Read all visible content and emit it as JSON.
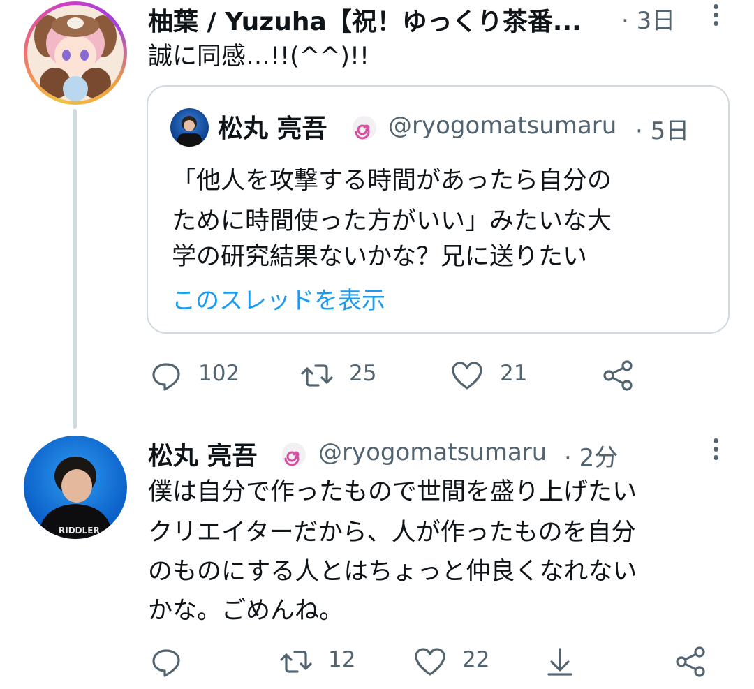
{
  "tweet1": {
    "display_name": "柚葉 / Yuzuha【祝！ゆっくり茶番...",
    "time": "· 3日",
    "text": "誠に同感…!!(^^)!!",
    "quote": {
      "display_name": "松丸 亮吾",
      "handle": "@ryogomatsumaru",
      "time": "· 5日",
      "lines": [
        "「他人を攻撃する時間があったら自分の",
        "ために時間使った方がいい」みたいな大",
        "学の研究結果ないかな？兄に送りたい"
      ],
      "show_thread": "このスレッドを表示"
    },
    "actions": {
      "replies": "102",
      "retweets": "25",
      "likes": "21"
    }
  },
  "tweet2": {
    "display_name": "松丸 亮吾",
    "handle": "@ryogomatsumaru",
    "time": "· 2分",
    "lines": [
      "僕は自分で作ったもので世間を盛り上げたい",
      "クリエイターだから、人が作ったものを自分",
      "のものにする人とはちょっと仲良くなれない",
      "かな。ごめんね。"
    ],
    "actions": {
      "replies": "",
      "retweets": "12",
      "likes": "22"
    }
  },
  "avatar2_shirt_text": "RIDDLER",
  "colors": {
    "link": "#1d9bf0",
    "muted": "#536471",
    "border": "#cfd9de"
  }
}
